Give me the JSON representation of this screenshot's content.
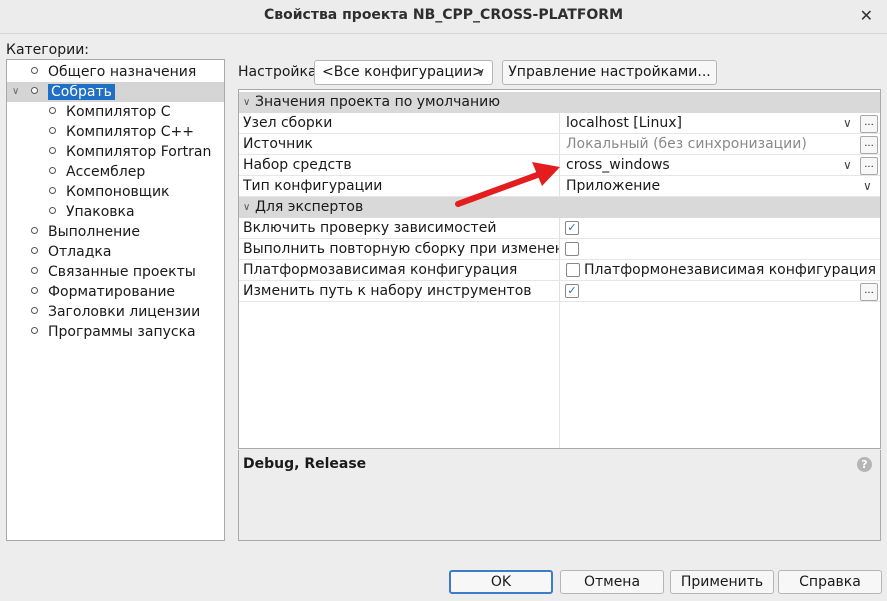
{
  "window": {
    "title": "Свойства проекта NB_CPP_CROSS-PLATFORM",
    "close_glyph": "✕"
  },
  "categories": {
    "label": "Категории:",
    "items": [
      {
        "label": "Общего назначения"
      },
      {
        "label": "Собрать",
        "selected": true,
        "expanded": true
      },
      {
        "label": "Компилятор C"
      },
      {
        "label": "Компилятор C++"
      },
      {
        "label": "Компилятор Fortran"
      },
      {
        "label": "Ассемблер"
      },
      {
        "label": "Компоновщик"
      },
      {
        "label": "Упаковка"
      },
      {
        "label": "Выполнение"
      },
      {
        "label": "Отладка"
      },
      {
        "label": "Связанные проекты"
      },
      {
        "label": "Форматирование"
      },
      {
        "label": "Заголовки лицензии"
      },
      {
        "label": "Программы запуска"
      }
    ]
  },
  "config": {
    "label": "Настройка:",
    "selected": "<Все конфигурации>",
    "manage_label": "Управление настройками..."
  },
  "properties": {
    "section1": "Значения проекта по умолчанию",
    "rows1": [
      {
        "name": "Узел сборки",
        "value": "localhost [Linux]"
      },
      {
        "name": "Источник",
        "value": "Локальный (без синхронизации)"
      },
      {
        "name": "Набор средств",
        "value": "cross_windows"
      },
      {
        "name": "Тип конфигурации",
        "value": "Приложение"
      }
    ],
    "section2": "Для экспертов",
    "rows2": [
      {
        "name": "Включить проверку зависимостей",
        "checked": true
      },
      {
        "name": "Выполнить повторную сборку при изменении с",
        "checked": false
      },
      {
        "name": "Платформозависимая конфигурация",
        "checked": false,
        "value": "Платформонезависимая конфигурация"
      },
      {
        "name": "Изменить путь к набору инструментов",
        "checked": true
      }
    ],
    "ellipsis": "..."
  },
  "description": {
    "text": "Debug, Release",
    "help": "?"
  },
  "buttons": {
    "ok": "OK",
    "cancel": "Отмена",
    "apply": "Применить",
    "help": "Справка"
  },
  "colors": {
    "accent": "#1f6fc5",
    "annotation_arrow": "#e41e1e"
  },
  "icons": {
    "chevron": "chevron-down-icon",
    "checkbox": "checkmark-icon",
    "help": "help-icon"
  }
}
